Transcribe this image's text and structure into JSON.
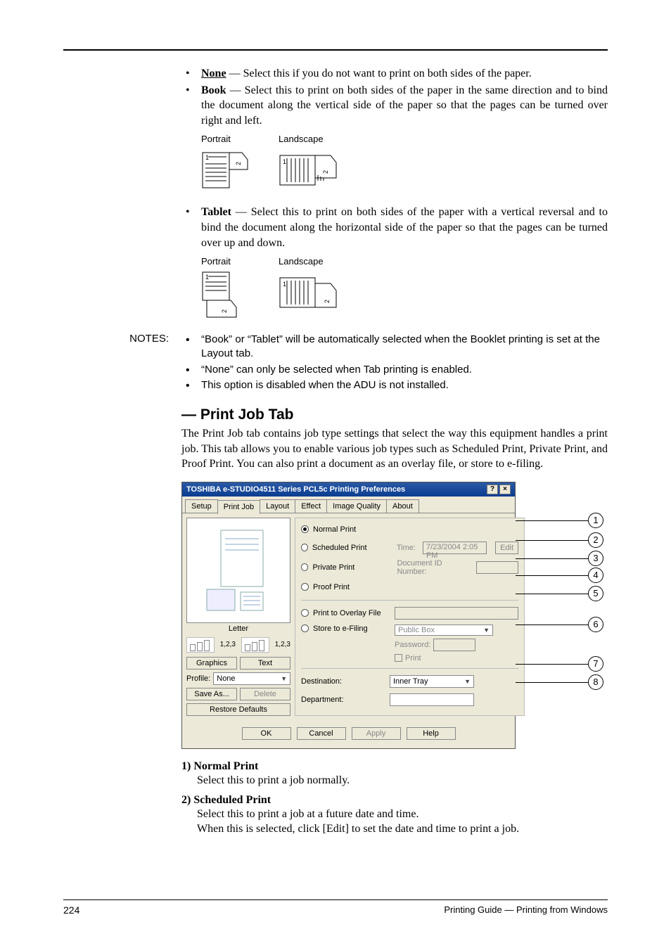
{
  "bullets_top": [
    {
      "term": "None",
      "underline": true,
      "text": " — Select this if you do not want to print on both sides of the paper."
    },
    {
      "term": "Book",
      "underline": false,
      "text": " — Select this to print on both sides of the paper in the same direction and to bind the document along the vertical side of the paper so that the pages can be turned over right and left."
    }
  ],
  "diagram1": {
    "portrait": "Portrait",
    "landscape": "Landscape"
  },
  "bullet_tablet": {
    "term": "Tablet",
    "text": " — Select this to print on both sides of the paper with a vertical reversal and to bind the document along the horizontal side of the paper so that the pages can be turned over up and down."
  },
  "diagram2": {
    "portrait": "Portrait",
    "landscape": "Landscape"
  },
  "notes_label": "NOTES:",
  "notes": [
    "“Book” or “Tablet” will be automatically selected when the Booklet printing is set at the Layout tab.",
    "“None” can only be selected when Tab printing is enabled.",
    "This option is disabled when the ADU is not installed."
  ],
  "section_heading": "— Print Job Tab",
  "section_para": "The Print Job tab contains job type settings that select the way this equipment handles a print job.  This tab allows you to enable various job types such as Scheduled Print, Private Print, and Proof Print.  You can also print a document as an overlay file, or store to e-filing.",
  "dialog": {
    "title": "TOSHIBA e-STUDIO4511 Series PCL5c Printing Preferences",
    "tabs": [
      "Setup",
      "Print Job",
      "Layout",
      "Effect",
      "Image Quality",
      "About"
    ],
    "active_tab": 1,
    "paper_caption": "Letter",
    "collate_a": "1,2,3",
    "collate_b": "1,2,3",
    "graphics_btn": "Graphics",
    "text_btn": "Text",
    "profile_label": "Profile:",
    "profile_value": "None",
    "saveas_btn": "Save As...",
    "delete_btn": "Delete",
    "restore_btn": "Restore Defaults",
    "opts": {
      "normal": "Normal Print",
      "scheduled": "Scheduled Print",
      "time_label": "Time:",
      "time_value": "7/23/2004 2:05 PM",
      "edit_btn": "Edit",
      "private": "Private Print",
      "docid_label": "Document ID Number:",
      "proof": "Proof Print",
      "overlay": "Print to Overlay File",
      "store": "Store to e-Filing",
      "store_box": "Public Box",
      "password_label": "Password:",
      "print_chk": "Print",
      "dest_label": "Destination:",
      "dest_value": "Inner Tray",
      "dept_label": "Department:"
    },
    "buttons": {
      "ok": "OK",
      "cancel": "Cancel",
      "apply": "Apply",
      "help": "Help"
    }
  },
  "callouts": [
    "1",
    "2",
    "3",
    "4",
    "5",
    "6",
    "7",
    "8"
  ],
  "definitions": [
    {
      "num": "1)",
      "term": "Normal Print",
      "body": [
        "Select this to print a job normally."
      ]
    },
    {
      "num": "2)",
      "term": "Scheduled Print",
      "body": [
        "Select this to print a job at a future date and time.",
        "When this is selected, click [Edit] to set the date and time to print a job."
      ]
    }
  ],
  "footer": {
    "page": "224",
    "text": "Printing Guide — Printing from Windows"
  }
}
